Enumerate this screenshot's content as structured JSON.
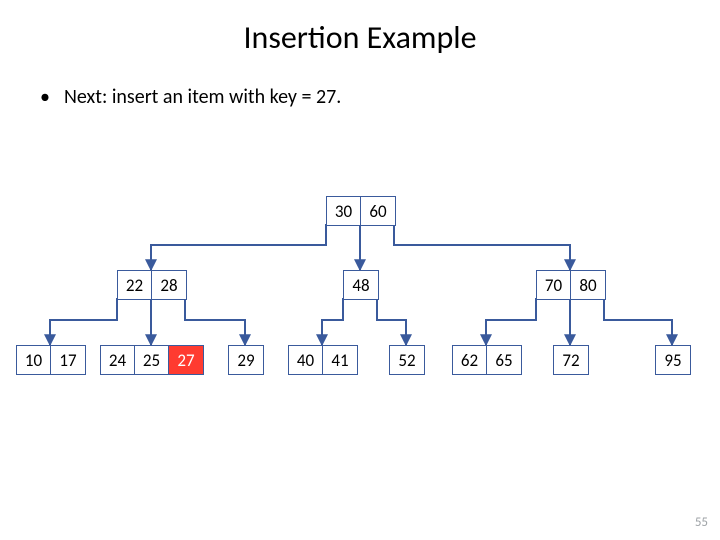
{
  "title": "Insertion Example",
  "bullet_text": "Next: insert an item with key = 27.",
  "slide_number": "55",
  "tree": {
    "root": [
      "30",
      "60"
    ],
    "mid": {
      "left": [
        "22",
        "28"
      ],
      "center": [
        "48"
      ],
      "right": [
        "70",
        "80"
      ]
    },
    "leaves": {
      "l0": [
        "10",
        "17"
      ],
      "l1": [
        "24",
        "25",
        "27"
      ],
      "l2": [
        "29"
      ],
      "l3": [
        "40",
        "41"
      ],
      "l4": [
        "52"
      ],
      "l5": [
        "62",
        "65"
      ],
      "l6": [
        "72"
      ],
      "l7": [
        "95"
      ]
    }
  },
  "highlight_key": "27",
  "colors": {
    "highlight": "#ff3b30",
    "border": "#3a5a9c"
  },
  "chart_data": {
    "type": "table",
    "description": "B-tree / 2-3-4 tree after inserting key 27",
    "levels": [
      {
        "level": 0,
        "nodes": [
          [
            30,
            60
          ]
        ]
      },
      {
        "level": 1,
        "nodes": [
          [
            22,
            28
          ],
          [
            48
          ],
          [
            70,
            80
          ]
        ]
      },
      {
        "level": 2,
        "nodes": [
          [
            10,
            17
          ],
          [
            24,
            25,
            27
          ],
          [
            29
          ],
          [
            40,
            41
          ],
          [
            52
          ],
          [
            62,
            65
          ],
          [
            72
          ],
          [
            95
          ]
        ]
      }
    ],
    "highlighted": [
      27
    ]
  }
}
